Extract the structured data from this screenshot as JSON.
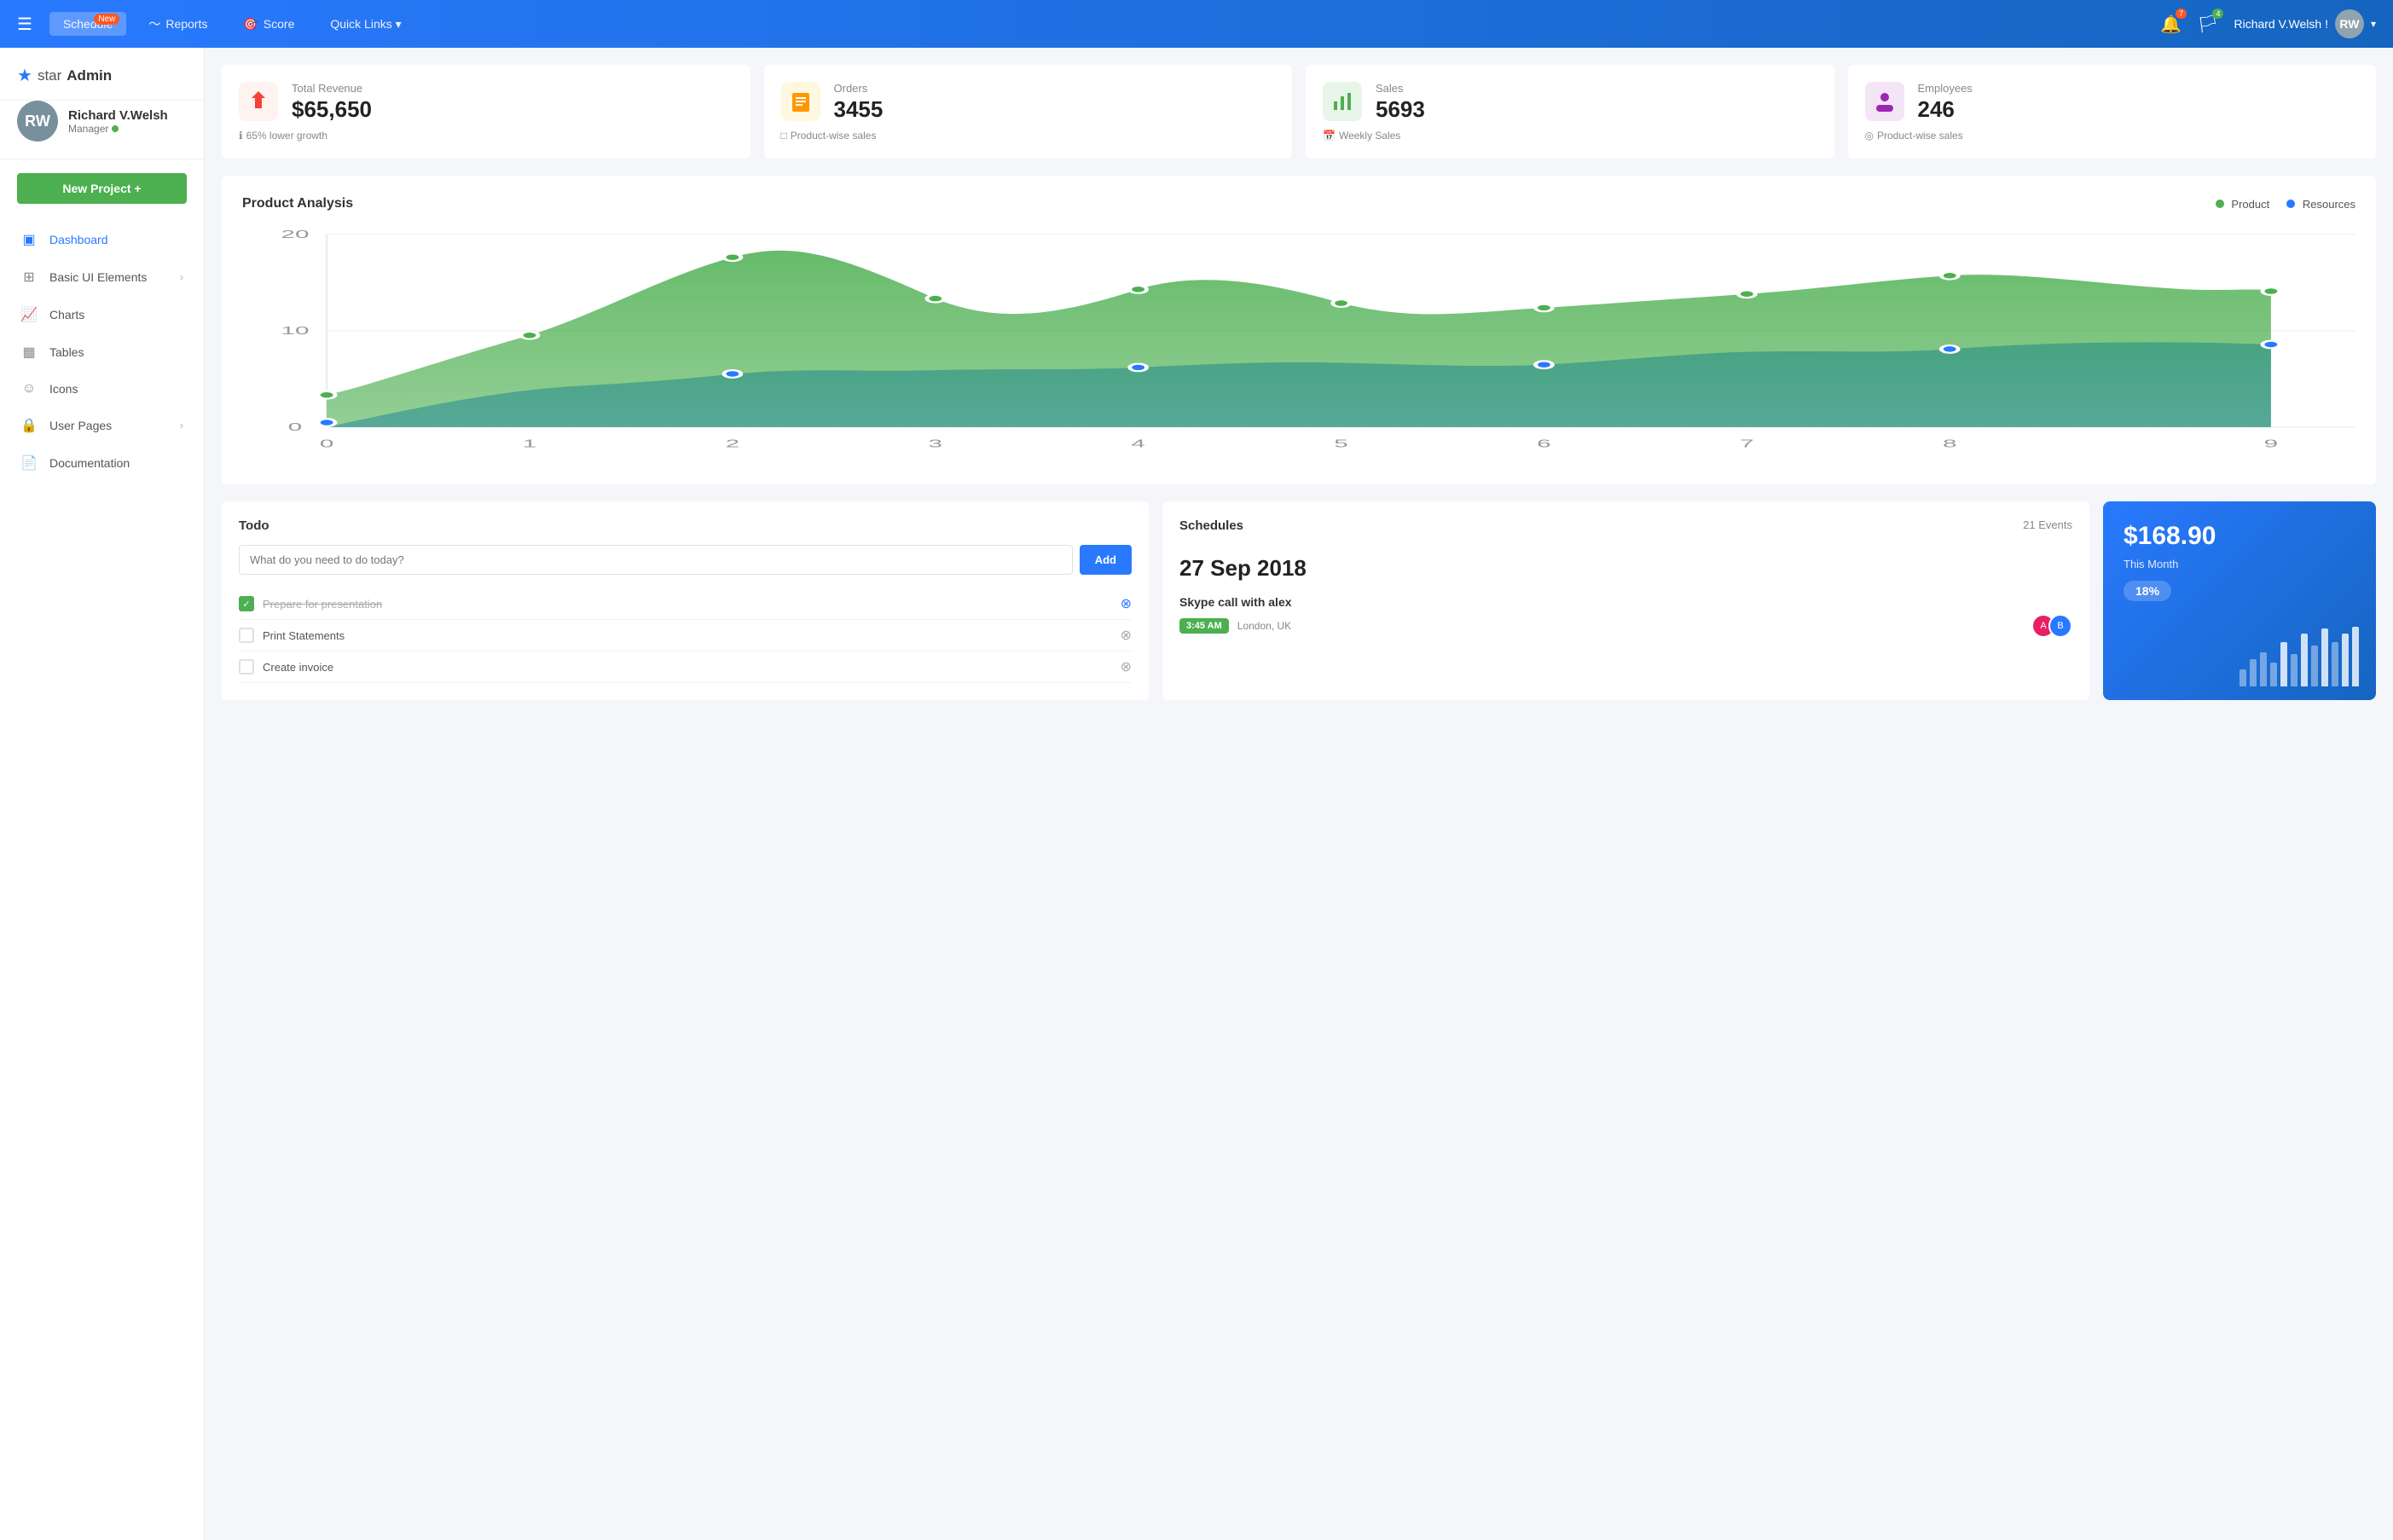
{
  "brand": {
    "name": "star",
    "name_bold": "Admin",
    "logo_icon": "★"
  },
  "topnav": {
    "hamburger": "☰",
    "items": [
      {
        "id": "schedule",
        "label": "Schedule",
        "badge": "New",
        "active": true
      },
      {
        "id": "reports",
        "label": "Reports",
        "icon": "📊",
        "active": false
      },
      {
        "id": "score",
        "label": "Score",
        "icon": "🎯",
        "active": false
      },
      {
        "id": "quick-links",
        "label": "Quick Links ▾",
        "active": false
      }
    ],
    "notifications_badge": "7",
    "alerts_badge": "4",
    "user_name": "Richard V.Welsh !",
    "user_initials": "RW"
  },
  "sidebar": {
    "user": {
      "name": "Richard V.Welsh",
      "role": "Manager",
      "online": true,
      "initials": "RW"
    },
    "new_project_label": "New Project +",
    "items": [
      {
        "id": "dashboard",
        "label": "Dashboard",
        "icon": "▣",
        "active": true,
        "has_chevron": false
      },
      {
        "id": "basic-ui",
        "label": "Basic UI Elements",
        "icon": "⊠",
        "active": false,
        "has_chevron": true
      },
      {
        "id": "charts",
        "label": "Charts",
        "icon": "📈",
        "active": false,
        "has_chevron": false
      },
      {
        "id": "tables",
        "label": "Tables",
        "icon": "▦",
        "active": false,
        "has_chevron": false
      },
      {
        "id": "icons",
        "label": "Icons",
        "icon": "☺",
        "active": false,
        "has_chevron": false
      },
      {
        "id": "user-pages",
        "label": "User Pages",
        "icon": "🔒",
        "active": false,
        "has_chevron": true
      },
      {
        "id": "documentation",
        "label": "Documentation",
        "icon": "📄",
        "active": false,
        "has_chevron": false
      }
    ]
  },
  "stats": [
    {
      "id": "revenue",
      "icon": "◆",
      "icon_color": "red",
      "label": "Total Revenue",
      "value": "$65,650",
      "sub_icon": "ℹ",
      "sub_text": "65% lower growth"
    },
    {
      "id": "orders",
      "icon": "≡",
      "icon_color": "orange",
      "label": "Orders",
      "value": "3455",
      "sub_icon": "□",
      "sub_text": "Product-wise sales"
    },
    {
      "id": "sales",
      "icon": "📊",
      "icon_color": "green",
      "label": "Sales",
      "value": "5693",
      "sub_icon": "📅",
      "sub_text": "Weekly Sales"
    },
    {
      "id": "employees",
      "icon": "👤",
      "icon_color": "purple",
      "label": "Employees",
      "value": "246",
      "sub_icon": "◎",
      "sub_text": "Product-wise sales"
    }
  ],
  "chart": {
    "title": "Product Analysis",
    "y_max": "20",
    "y_mid": "10",
    "y_min": "0",
    "x_labels": [
      "0",
      "1",
      "2",
      "3",
      "4",
      "5",
      "6",
      "7",
      "8",
      "9"
    ],
    "legend": [
      {
        "label": "Product",
        "color": "#4caf50"
      },
      {
        "label": "Resources",
        "color": "#2979ff"
      }
    ]
  },
  "todo": {
    "title": "Todo",
    "input_placeholder": "What do you need to do today?",
    "add_button": "Add",
    "items": [
      {
        "id": 1,
        "text": "Prepare for presentation",
        "done": true
      },
      {
        "id": 2,
        "text": "Print Statements",
        "done": false
      },
      {
        "id": 3,
        "text": "Create invoice",
        "done": false
      }
    ]
  },
  "schedules": {
    "title": "Schedules",
    "date": "27 Sep 2018",
    "events_count": "21 Events",
    "event": {
      "title": "Skype call with alex",
      "time": "3:45 AM",
      "location": "London, UK"
    }
  },
  "revenue_card": {
    "amount": "$168.90",
    "label": "This Month",
    "percent": "18%",
    "bars": [
      20,
      35,
      45,
      30,
      55,
      40,
      60,
      50,
      70,
      55,
      65,
      75
    ]
  }
}
